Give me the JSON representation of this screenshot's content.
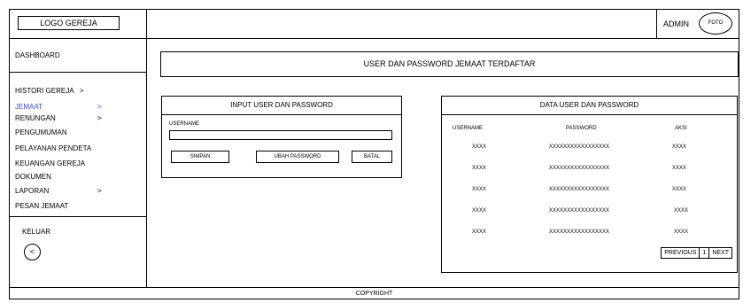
{
  "header": {
    "logo_label": "LOGO GEREJA",
    "admin_label": "ADMIN",
    "avatar_label": "FOTO"
  },
  "sidebar": {
    "items": [
      {
        "label": "DASHBOARD",
        "arrow": ""
      },
      {
        "label": "HISTORI GEREJA",
        "arrow": ">"
      },
      {
        "label": "JEMAAT",
        "arrow": ">"
      },
      {
        "label": "RENUNGAN",
        "arrow": ">"
      },
      {
        "label": "PENGUMUMAN",
        "arrow": ""
      },
      {
        "label": "PELAYANAN PENDETA",
        "arrow": ""
      },
      {
        "label": "KEUANGAN GEREJA",
        "arrow": ""
      },
      {
        "label": "DOKUMEN",
        "arrow": ""
      },
      {
        "label": "LAPORAN",
        "arrow": ">"
      },
      {
        "label": "PESAN JEMAAT",
        "arrow": ""
      }
    ],
    "logout_label": "KELUAR",
    "back_label": "<"
  },
  "main": {
    "title": "USER DAN PASSWORD JEMAAT TERDAFTAR",
    "form": {
      "title": "INPUT USER DAN PASSWORD",
      "username_label": "USERNAME",
      "username_value": "",
      "save_label": "SIMPAN",
      "change_password_label": "UBAH PASSWORD",
      "cancel_label": "BATAL"
    },
    "table": {
      "title": "DATA USER DAN PASSWORD",
      "columns": [
        "USERNAME",
        "PASSWORD",
        "AKSI"
      ],
      "rows": [
        [
          "XXXX",
          "XXXXXXXXXXXXXXXXX",
          "XXXX"
        ],
        [
          "XXXX",
          "XXXXXXXXXXXXXXXXX",
          "XXXX"
        ],
        [
          "XXXX",
          "XXXXXXXXXXXXXXXXX",
          "XXXX"
        ],
        [
          "XXXX",
          "XXXXXXXXXXXXXXXXX",
          "XXXX"
        ],
        [
          "XXXX",
          "XXXXXXXXXXXXXXXXX",
          "XXXX"
        ]
      ],
      "pagination": {
        "previous": "PREVIOUS",
        "page": "1",
        "next": "NEXT"
      }
    }
  },
  "footer": {
    "copyright": "COPYRIGHT"
  }
}
